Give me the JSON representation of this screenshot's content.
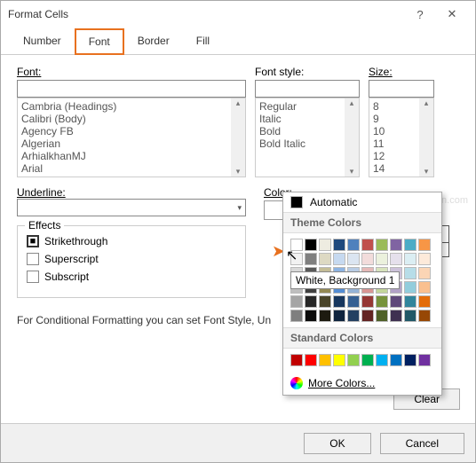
{
  "window": {
    "title": "Format Cells",
    "help_icon": "?",
    "close_icon": "✕"
  },
  "tabs": {
    "number": "Number",
    "font": "Font",
    "border": "Border",
    "fill": "Fill"
  },
  "labels": {
    "font": "Font:",
    "font_style": "Font style:",
    "size": "Size:",
    "underline": "Underline:",
    "color": "Color:",
    "effects": "Effects"
  },
  "font_list": [
    "Cambria (Headings)",
    "Calibri (Body)",
    "Agency FB",
    "Algerian",
    "ArhialkhanMJ",
    "Arial"
  ],
  "style_list": [
    "Regular",
    "Italic",
    "Bold",
    "Bold Italic"
  ],
  "size_list": [
    "8",
    "9",
    "10",
    "11",
    "12",
    "14"
  ],
  "effects": {
    "strikethrough": "Strikethrough",
    "superscript": "Superscript",
    "subscript": "Subscript"
  },
  "color": {
    "automatic": "Automatic",
    "popup_automatic": "Automatic",
    "theme_header": "Theme Colors",
    "standard_header": "Standard Colors",
    "more": "More Colors...",
    "tooltip": "White, Background 1",
    "theme_row1": [
      "#ffffff",
      "#000000",
      "#eeece1",
      "#1f497d",
      "#4f81bd",
      "#c0504d",
      "#9bbb59",
      "#8064a2",
      "#4bacc6",
      "#f79646"
    ],
    "theme_shades": [
      [
        "#f2f2f2",
        "#7f7f7f",
        "#ddd9c3",
        "#c6d9f0",
        "#dbe5f1",
        "#f2dcdb",
        "#ebf1dd",
        "#e5e0ec",
        "#dbeef3",
        "#fdeada"
      ],
      [
        "#d8d8d8",
        "#595959",
        "#c4bd97",
        "#8db3e2",
        "#b8cce4",
        "#e5b9b7",
        "#d7e3bc",
        "#ccc1d9",
        "#b7dde8",
        "#fbd5b5"
      ],
      [
        "#bfbfbf",
        "#3f3f3f",
        "#938953",
        "#548dd4",
        "#95b3d7",
        "#d99694",
        "#c3d69b",
        "#b2a2c7",
        "#92cddc",
        "#fac08f"
      ],
      [
        "#a5a5a5",
        "#262626",
        "#494429",
        "#17365d",
        "#366092",
        "#953734",
        "#76923c",
        "#5f497a",
        "#31859b",
        "#e36c09"
      ],
      [
        "#7f7f7f",
        "#0c0c0c",
        "#1d1b10",
        "#0f243e",
        "#244061",
        "#632423",
        "#4f6128",
        "#3f3151",
        "#205867",
        "#974806"
      ]
    ],
    "standard": [
      "#c00000",
      "#ff0000",
      "#ffc000",
      "#ffff00",
      "#92d050",
      "#00b050",
      "#00b0f0",
      "#0070c0",
      "#002060",
      "#7030a0"
    ]
  },
  "note": "For Conditional Formatting you can set Font Style, Un",
  "buttons": {
    "clear": "Clear",
    "ok": "OK",
    "cancel": "Cancel"
  },
  "watermark": "wsxdn.com"
}
